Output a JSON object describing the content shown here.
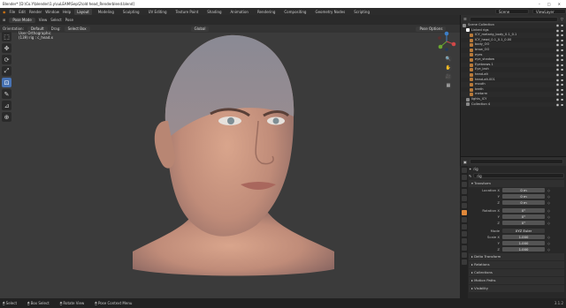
{
  "window": {
    "title": "Blender* [D:\\Co.Y\\blender\\1.y\\suLEAM\\Sep\\2\\old head_Renderblend.blend]",
    "controls": [
      "–",
      "□",
      "✕"
    ]
  },
  "menu": [
    "File",
    "Edit",
    "Render",
    "Window",
    "Help"
  ],
  "workspaces": [
    "Layout",
    "Modeling",
    "Sculpting",
    "UV Editing",
    "Texture Paint",
    "Shading",
    "Animation",
    "Rendering",
    "Compositing",
    "Geometry Nodes",
    "Scripting"
  ],
  "scene": {
    "name": "Scene",
    "layer": "ViewLayer"
  },
  "v3dheader": {
    "mode": "Pose Mode",
    "view": "View",
    "select": "Select",
    "pose": "Pose",
    "orientation_label": "Orientation:",
    "orientation": "Default",
    "drag_label": "Drag:",
    "drag": "Select Box",
    "pivot": "Global",
    "options": "Pose Options"
  },
  "viewport": {
    "view_name": "User Orthographic",
    "object_info": "(139) rig : c_head.x"
  },
  "tools": [
    "⬚",
    "✥",
    "⟳",
    "⤢",
    "⊡",
    "✎",
    "⊿",
    "⊕"
  ],
  "nav_icons": [
    "🔍",
    "✋",
    "🎥",
    "▦"
  ],
  "outliner": {
    "title": "Scene Collection",
    "items": [
      {
        "label": "Scene Collection",
        "color": "#888888"
      },
      {
        "label": "Linked rigs",
        "color": "#ffffff"
      },
      {
        "label": "ICY_metarig_body_0.1_0.1",
        "color": "#b87a3a"
      },
      {
        "label": "ICY_head_0.1_0.1_0.00",
        "color": "#b87a3a"
      },
      {
        "label": "body_OO",
        "color": "#b87a3a"
      },
      {
        "label": "brow_OO",
        "color": "#b87a3a"
      },
      {
        "label": "eyes",
        "color": "#b87a3a"
      },
      {
        "label": "eye_shadow",
        "color": "#b87a3a"
      },
      {
        "label": "Eyebrows.1",
        "color": "#b87a3a"
      },
      {
        "label": "Eye_lash",
        "color": "#b87a3a"
      },
      {
        "label": "head-alt",
        "color": "#b87a3a"
      },
      {
        "label": "head-alt.001",
        "color": "#b87a3a"
      },
      {
        "label": "mouth",
        "color": "#b87a3a"
      },
      {
        "label": "teeth",
        "color": "#b87a3a"
      },
      {
        "label": "metarm",
        "color": "#b87a3a"
      },
      {
        "label": "lights_ICY",
        "color": "#888888"
      },
      {
        "label": "Collection 4",
        "color": "#888888"
      }
    ]
  },
  "properties": {
    "object_name": "rig",
    "bone_name": "rig",
    "transform": "Transform",
    "location": [
      {
        "label": "Location X",
        "value": "0 m"
      },
      {
        "label": "Y",
        "value": "0 m"
      },
      {
        "label": "Z",
        "value": "0 m"
      }
    ],
    "rotation": [
      {
        "label": "Rotation X",
        "value": "0°"
      },
      {
        "label": "Y",
        "value": "0°"
      },
      {
        "label": "Z",
        "value": "0°"
      }
    ],
    "mode_label": "Mode",
    "mode": "XYZ Euler",
    "scale": [
      {
        "label": "Scale X",
        "value": "1.000"
      },
      {
        "label": "Y",
        "value": "1.000"
      },
      {
        "label": "Z",
        "value": "1.000"
      }
    ],
    "sections": [
      "Delta Transform",
      "Relations",
      "Collections",
      "Motion Paths",
      "Visibility"
    ]
  },
  "status": {
    "select": "Select",
    "box_select": "Box Select",
    "rotate_view": "Rotate View",
    "context_menu": "Pose Context Menu",
    "version": "3.1.2"
  }
}
